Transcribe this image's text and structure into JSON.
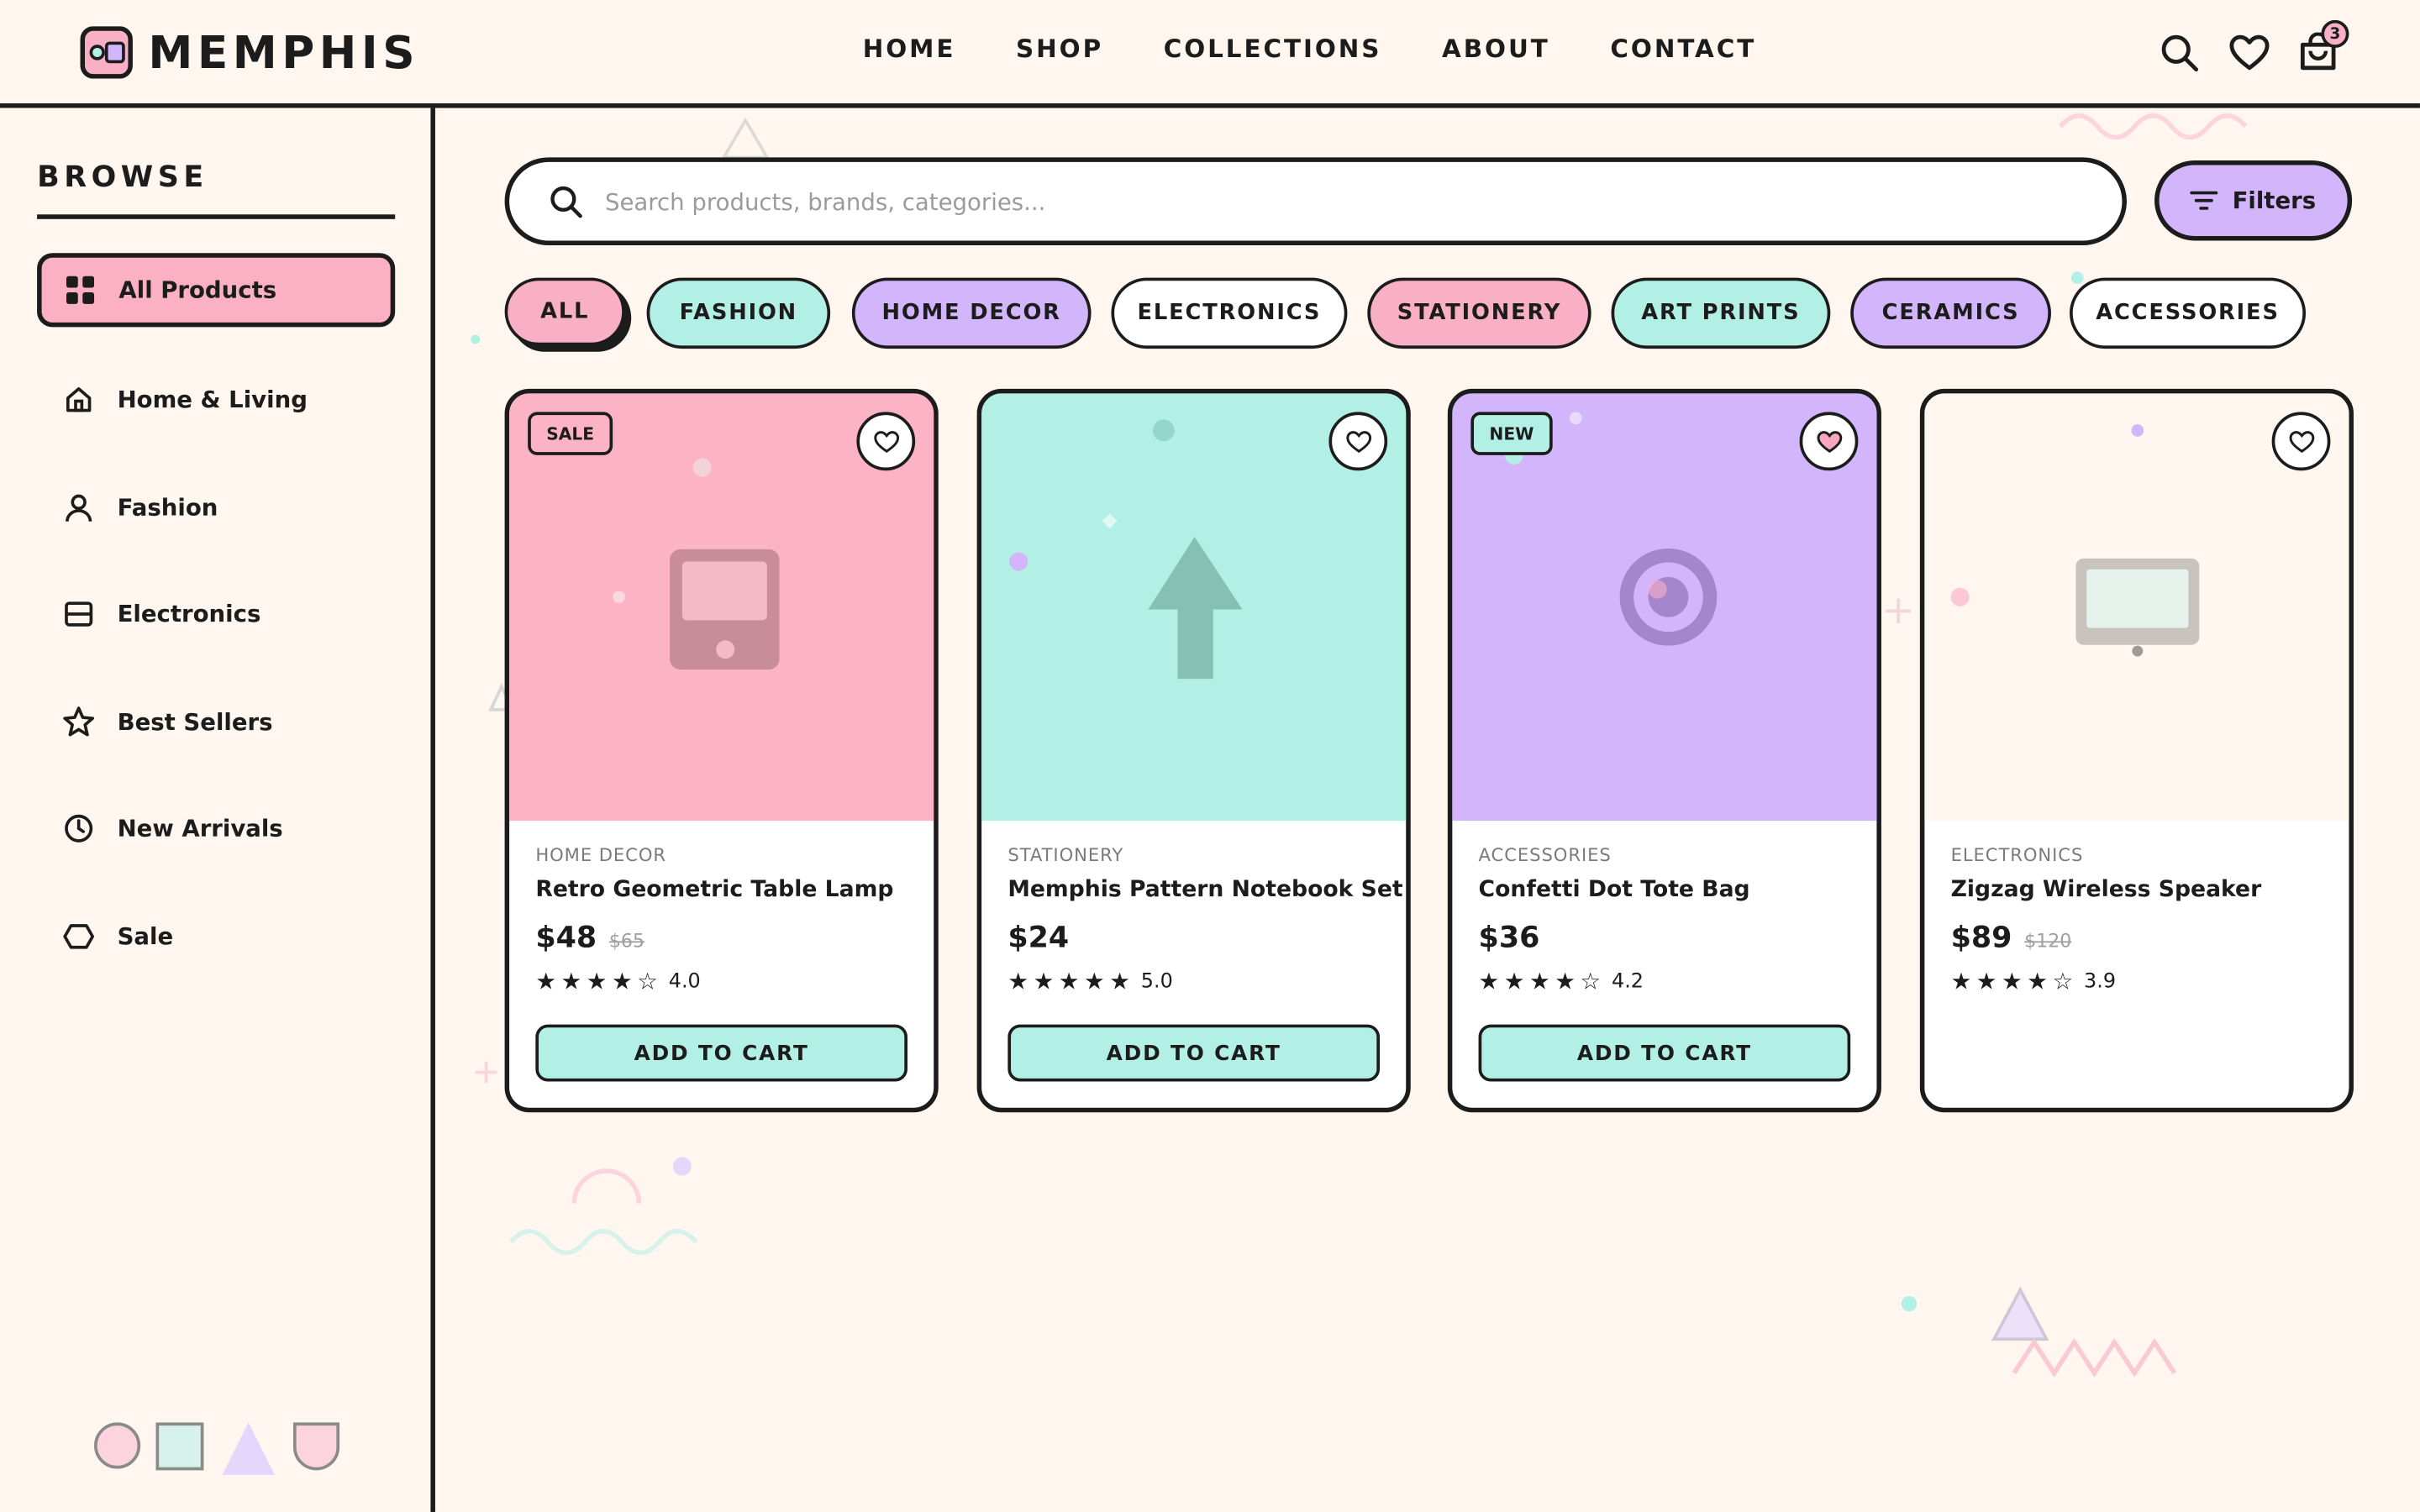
{
  "brand": {
    "name": "MEMPHIS"
  },
  "nav": {
    "items": [
      "HOME",
      "SHOP",
      "COLLECTIONS",
      "ABOUT",
      "CONTACT"
    ]
  },
  "header_icons": {
    "search": "search-icon",
    "wishlist": "heart-icon",
    "cart": "shopping-bag-icon",
    "cart_count": "3"
  },
  "sidebar": {
    "title": "BROWSE",
    "items": [
      {
        "label": "All Products",
        "icon": "grid-icon",
        "active": true
      },
      {
        "label": "Home & Living",
        "icon": "home-icon"
      },
      {
        "label": "Fashion",
        "icon": "person-icon"
      },
      {
        "label": "Electronics",
        "icon": "device-icon"
      },
      {
        "label": "Best Sellers",
        "icon": "star-icon"
      },
      {
        "label": "New Arrivals",
        "icon": "clock-icon"
      },
      {
        "label": "Sale",
        "icon": "tag-icon"
      }
    ]
  },
  "search": {
    "placeholder": "Search products, brands, categories..."
  },
  "filters": {
    "label": "Filters"
  },
  "chips": [
    {
      "label": "ALL",
      "color": "#f9b0c6"
    },
    {
      "label": "FASHION",
      "color": "#b2efe4"
    },
    {
      "label": "HOME DECOR",
      "color": "#d2b5fb"
    },
    {
      "label": "ELECTRONICS",
      "color": "#ffffff"
    },
    {
      "label": "STATIONERY",
      "color": "#f9b0c6"
    },
    {
      "label": "ART PRINTS",
      "color": "#b2efe4"
    },
    {
      "label": "CERAMICS",
      "color": "#d2b5fb"
    },
    {
      "label": "ACCESSORIES",
      "color": "#ffffff"
    }
  ],
  "products": [
    {
      "badge": "SALE",
      "category": "HOME DECOR",
      "name": "Retro Geometric Table Lamp",
      "price": "$48",
      "old_price": "$65",
      "rating": "4.0",
      "stars": 4,
      "cta": "ADD TO CART",
      "bg": "#fdb3c6",
      "favorited": false
    },
    {
      "badge": "",
      "category": "STATIONERY",
      "name": "Memphis Pattern Notebook Set",
      "price": "$24",
      "old_price": "",
      "rating": "5.0",
      "stars": 5,
      "cta": "ADD TO CART",
      "bg": "#b2efe4",
      "favorited": false
    },
    {
      "badge": "NEW",
      "category": "ACCESSORIES",
      "name": "Confetti Dot Tote Bag",
      "price": "$36",
      "old_price": "",
      "rating": "4.2",
      "stars": 4,
      "cta": "ADD TO CART",
      "bg": "#d2b5fb",
      "favorited": true
    },
    {
      "badge": "",
      "category": "ELECTRONICS",
      "name": "Zigzag Wireless Speaker",
      "price": "$89",
      "old_price": "$120",
      "rating": "3.9",
      "stars": 4,
      "cta": "",
      "bg": "#fef6ef",
      "favorited": false
    }
  ]
}
